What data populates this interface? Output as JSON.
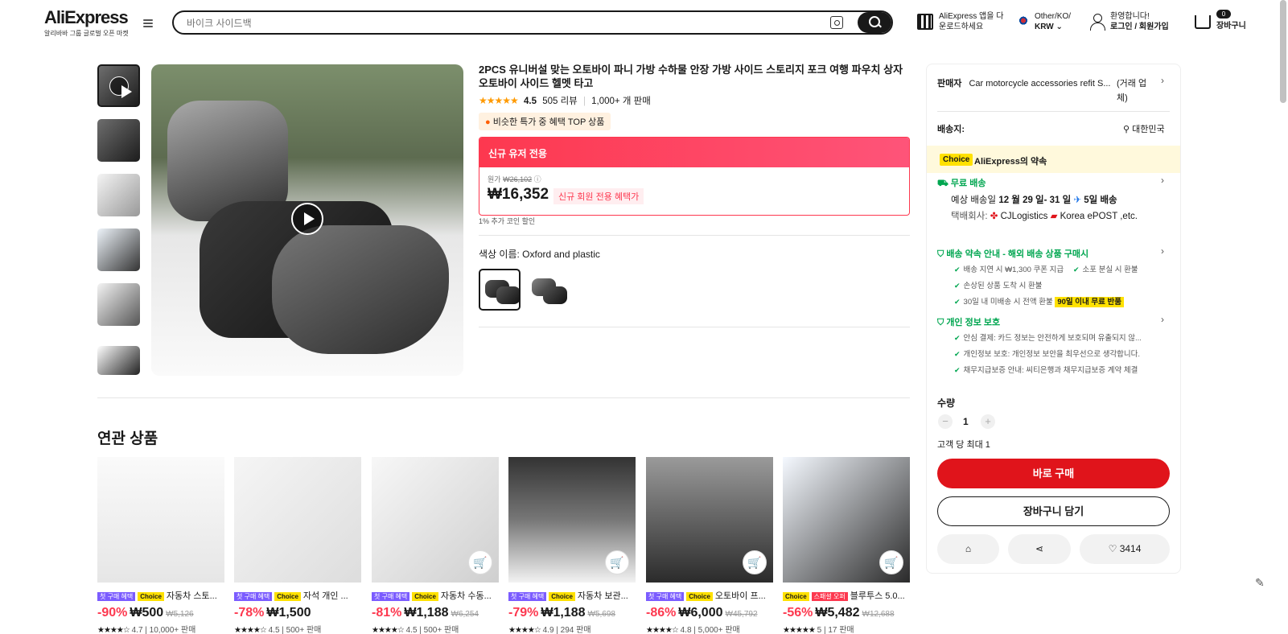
{
  "header": {
    "logo": "AliExpress",
    "logo_sub": "알리바바 그룹 글로벌 오픈 마켓",
    "search_placeholder": "바이크 사이드백",
    "app_line1": "AliExpress 앱을 다",
    "app_line2": "운로드하세요",
    "locale_line1": "Other/KO/",
    "locale_line2": "KRW",
    "user_line1": "환영합니다!",
    "user_line2": "로그인 / 회원가입",
    "cart_count": "0",
    "cart_label": "장바구니"
  },
  "product": {
    "title": "2PCS 유니버설 맞는 오토바이 파니 가방 수하물 안장 가방 사이드 스토리지 포크 여행 파우치 상자 오토바이 사이드 헬멧 타고",
    "stars": "★★★★★",
    "rating": "4.5",
    "reviews": "505 리뷰",
    "sold": "1,000+ 개 판매",
    "top_badge": "비슷한 특가 중 혜택 TOP 상품",
    "promo_banner": "신규 유저 전용",
    "orig_label": "원가",
    "orig_price": "₩26,102",
    "price": "₩16,352",
    "price_tag": "신규 회원 전용 혜택가",
    "coin_note": "1% 추가 코인 할인",
    "color_label": "색상 이름: Oxford and plastic"
  },
  "related": {
    "heading": "연관 상품",
    "items": [
      {
        "tag1": "첫 구매 혜택",
        "tag2": "Choice",
        "name": "자동차 스토...",
        "disc": "-90%",
        "price": "₩500",
        "old": "₩5,126",
        "stars": "★★★★☆",
        "rating": "4.7",
        "sold": "10,000+ 판매"
      },
      {
        "tag1": "첫 구매 혜택",
        "tag2": "Choice",
        "name": "자석 개인 ...",
        "disc": "-78%",
        "price": "₩1,500",
        "old": "",
        "stars": "★★★★☆",
        "rating": "4.5",
        "sold": "500+ 판매"
      },
      {
        "tag1": "첫 구매 혜택",
        "tag2": "Choice",
        "name": "자동차 수동...",
        "disc": "-81%",
        "price": "₩1,188",
        "old": "₩6,254",
        "stars": "★★★★☆",
        "rating": "4.5",
        "sold": "500+ 판매"
      },
      {
        "tag1": "첫 구매 혜택",
        "tag2": "Choice",
        "name": "자동차 보관...",
        "disc": "-79%",
        "price": "₩1,188",
        "old": "₩5,698",
        "stars": "★★★★☆",
        "rating": "4.9",
        "sold": "294 판매"
      },
      {
        "tag1": "첫 구매 혜택",
        "tag2": "Choice",
        "name": "오토바이 프...",
        "disc": "-86%",
        "price": "₩6,000",
        "old": "₩45,792",
        "stars": "★★★★☆",
        "rating": "4.8",
        "sold": "5,000+ 판매"
      },
      {
        "tag1": "Choice",
        "tag2": "스패셜 오퍼",
        "name": "블루투스 5.0...",
        "disc": "-56%",
        "price": "₩5,482",
        "old": "₩12,688",
        "stars": "★★★★★",
        "rating": "5",
        "sold": "17 판매"
      }
    ]
  },
  "panel": {
    "seller_label": "판매자",
    "seller_name": "Car motorcycle accessories refit S...",
    "seller_status": "(거래 업체)",
    "ship_label": "배송지:",
    "ship_dest": "대한민국",
    "choice_tag": "Choice",
    "promise": "AliExpress의 약속",
    "free_ship": "무료 배송",
    "est_prefix": "예상 배송일",
    "est_dates": "12 월 29 일- 31 일",
    "est_days": "5일 배송",
    "carrier_label": "택배회사:",
    "carrier1": "CJLogistics",
    "carrier2": "Korea",
    "carrier3": "ePOST ,etc.",
    "guarantee_title": "배송 약속 안내 - 해외 배송 상품 구매시",
    "g1": "배송 지연 시 ₩1,300 쿠폰 지급",
    "g2": "소포 분실 시 환불",
    "g3": "손상된 상품 도착 시 환불",
    "g4": "30일 내 미배송 시 전액 환불",
    "g4_tag": "90일 이내 무료 반품",
    "privacy_title": "개인 정보 보호",
    "p1": "안심 결제: 카드 정보는 안전하게 보호되며 유출되지 않...",
    "p2": "개인정보 보호: 개인정보 보안을 최우선으로 생각합니다.",
    "p3": "채무지급보증 안내: 씨티은행과 채무지급보증 계약 체결",
    "qty_label": "수량",
    "qty": "1",
    "limit": "고객 당 최대 1",
    "buy_now": "바로 구매",
    "add_cart": "장바구니 담기",
    "wish_count": "3414"
  },
  "colors": {
    "accent": "#e0141b",
    "promo": "#fd384f",
    "green": "#00a650",
    "choice": "#ffe100"
  }
}
